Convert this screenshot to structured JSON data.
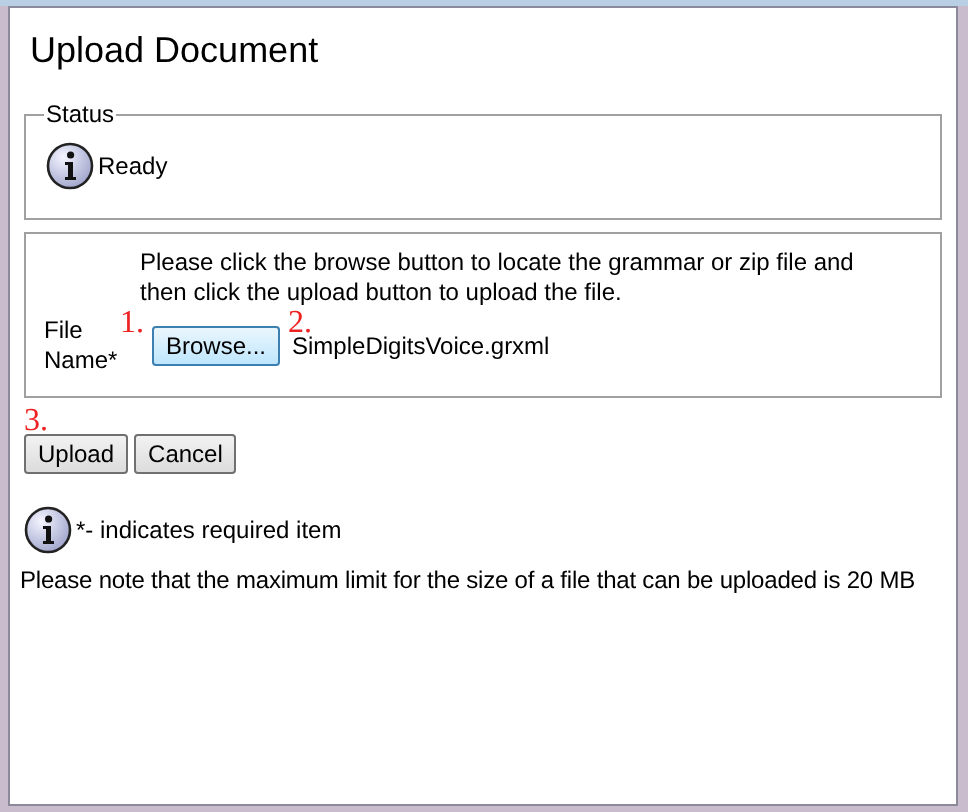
{
  "title": "Upload Document",
  "status": {
    "legend": "Status",
    "message": "Ready"
  },
  "upload": {
    "instructions": "Please click the browse button to locate the grammar or zip file and then click the upload button to upload the file.",
    "field_label": "File Name*",
    "browse_button": "Browse...",
    "file_name": "SimpleDigitsVoice.grxml"
  },
  "annotations": [
    "1.",
    "2.",
    "3."
  ],
  "buttons": [
    "Upload",
    "Cancel"
  ],
  "required_note": "*- indicates required item",
  "size_note": "Please note that the maximum limit for the size of a file that can be uploaded is 20 MB"
}
